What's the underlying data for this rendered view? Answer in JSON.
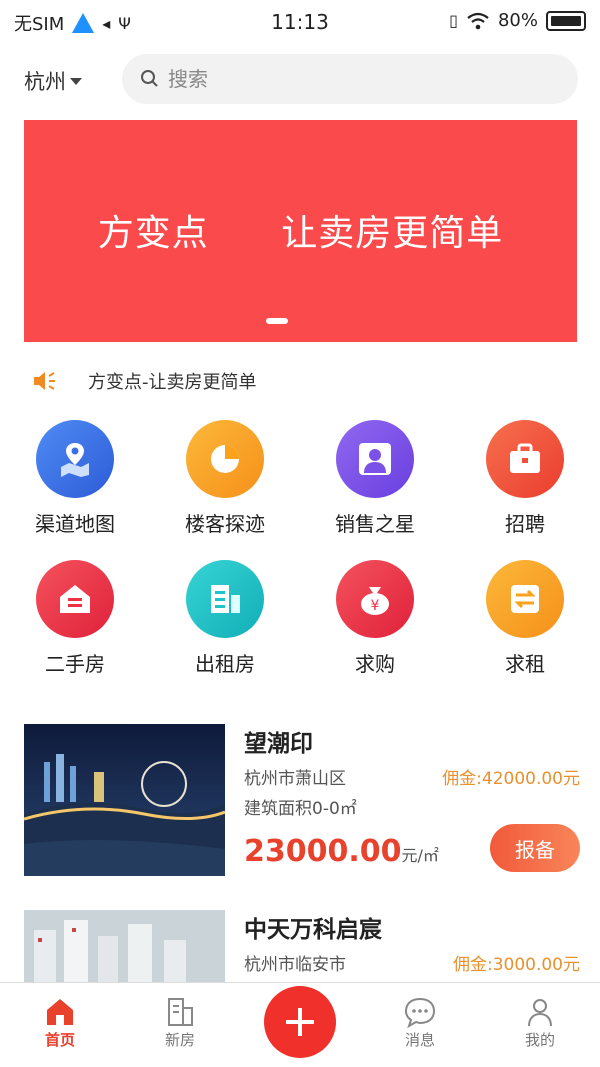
{
  "status_bar": {
    "carrier": "无SIM",
    "time": "11:13",
    "battery": "80%"
  },
  "header": {
    "city": "杭州",
    "search_placeholder": "搜索"
  },
  "banner": {
    "text": "方变点 让卖房更简单"
  },
  "notice": {
    "text": "方变点-让卖房更简单"
  },
  "grid": [
    {
      "label": "渠道地图",
      "icon": "map-icon",
      "color": "#3a6fe6"
    },
    {
      "label": "楼客探迹",
      "icon": "pie-chart-icon",
      "color": "#f9a21a"
    },
    {
      "label": "销售之星",
      "icon": "person-icon",
      "color": "#7b52e8"
    },
    {
      "label": "招聘",
      "icon": "briefcase-icon",
      "color": "#f0503a"
    },
    {
      "label": "二手房",
      "icon": "house-icon",
      "color": "#ee3045"
    },
    {
      "label": "出租房",
      "icon": "building-icon",
      "color": "#1fc4c8"
    },
    {
      "label": "求购",
      "icon": "money-bag-icon",
      "color": "#ee3045"
    },
    {
      "label": "求租",
      "icon": "exchange-icon",
      "color": "#f9a21a"
    }
  ],
  "listings": [
    {
      "title": "望潮印",
      "location": "杭州市萧山区",
      "commission": "佣金:42000.00元",
      "area": "建筑面积0-0㎡",
      "price": "23000.00",
      "price_unit": "元/㎡",
      "button": "报备"
    },
    {
      "title": "中天万科启宸",
      "location": "杭州市临安市",
      "commission": "佣金:3000.00元"
    }
  ],
  "tabbar": [
    {
      "label": "首页",
      "icon": "home-icon"
    },
    {
      "label": "新房",
      "icon": "building-icon"
    },
    {
      "label": "消息",
      "icon": "chat-icon"
    },
    {
      "label": "我的",
      "icon": "user-icon"
    }
  ]
}
